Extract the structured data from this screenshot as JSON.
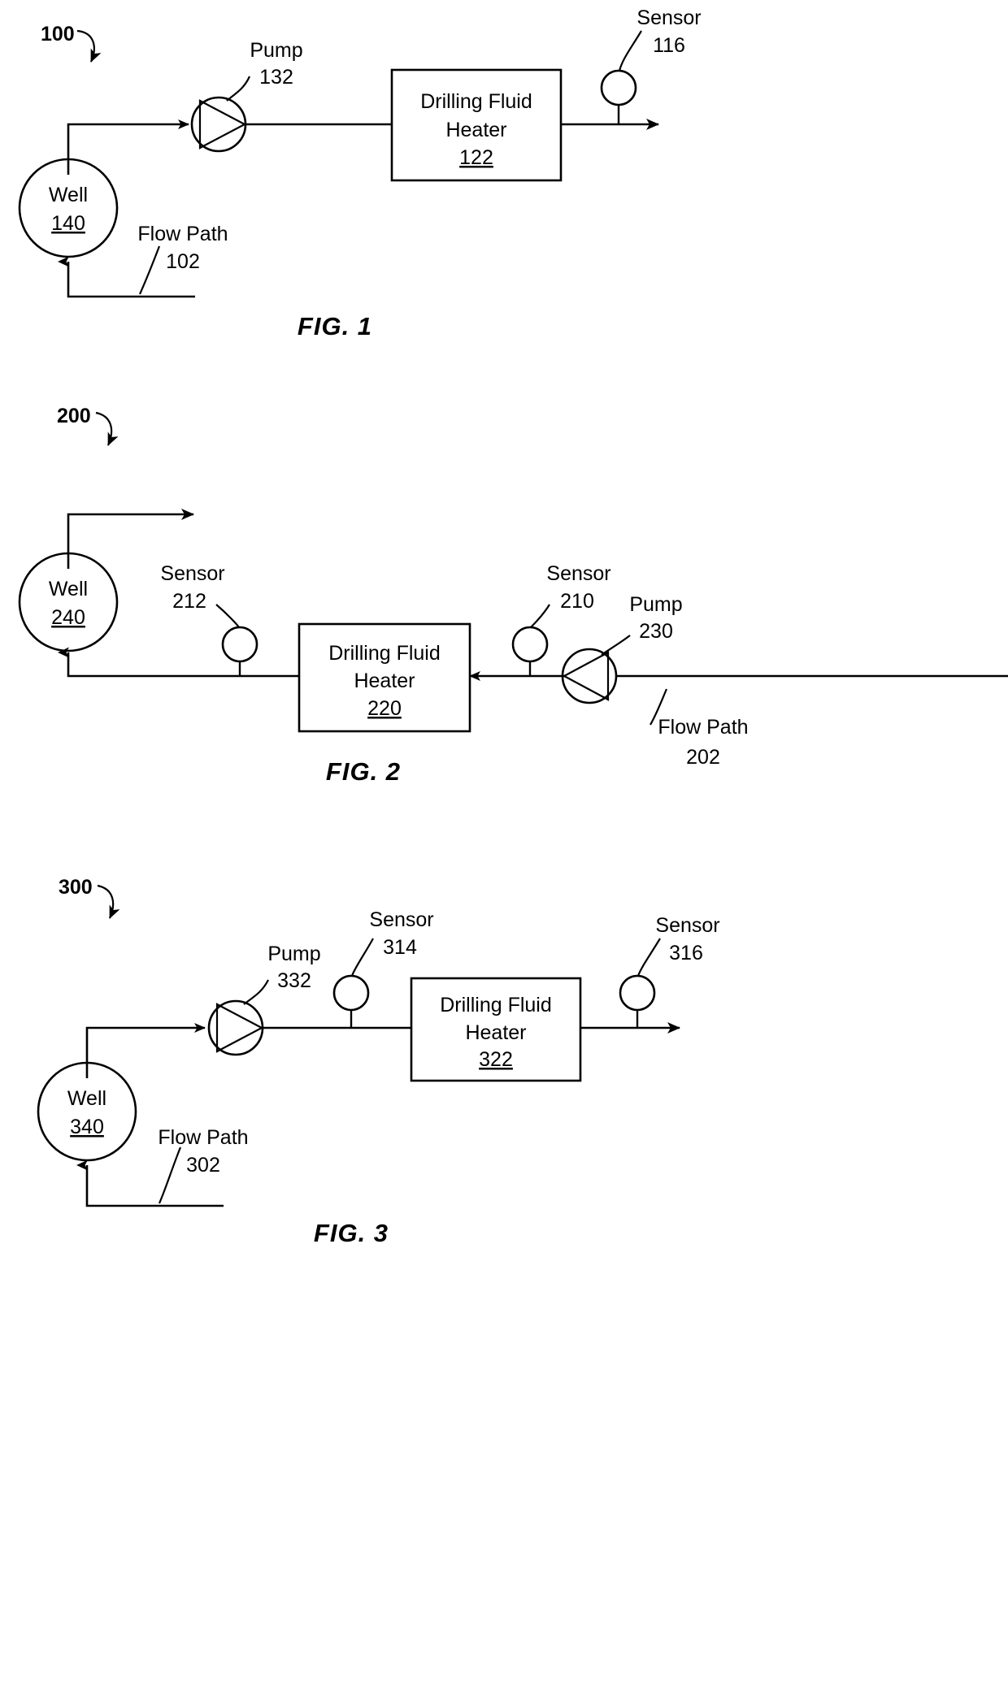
{
  "page": {
    "kind": "patent-drawing-sheet",
    "figure_count": 3,
    "stroke_color": "#000000",
    "background_color": "#ffffff"
  },
  "figures": [
    {
      "id": "fig1",
      "caption": "FIG. 1",
      "system_ref": "100",
      "nodes": {
        "well": {
          "label": "Well",
          "ref": "140"
        },
        "pump": {
          "label": "Pump",
          "ref": "132"
        },
        "heater": {
          "line1": "Drilling Fluid",
          "line2": "Heater",
          "ref": "122"
        },
        "sensor_out": {
          "label": "Sensor",
          "ref": "116"
        },
        "flow_path": {
          "label": "Flow Path",
          "ref": "102"
        }
      }
    },
    {
      "id": "fig2",
      "caption": "FIG. 2",
      "system_ref": "200",
      "nodes": {
        "well": {
          "label": "Well",
          "ref": "240"
        },
        "pump": {
          "label": "Pump",
          "ref": "230"
        },
        "heater": {
          "line1": "Drilling Fluid",
          "line2": "Heater",
          "ref": "220"
        },
        "sensor_out": {
          "label": "Sensor",
          "ref": "212"
        },
        "sensor_in": {
          "label": "Sensor",
          "ref": "210"
        },
        "flow_path": {
          "label": "Flow Path",
          "ref": "202"
        }
      }
    },
    {
      "id": "fig3",
      "caption": "FIG. 3",
      "system_ref": "300",
      "nodes": {
        "well": {
          "label": "Well",
          "ref": "340"
        },
        "pump": {
          "label": "Pump",
          "ref": "332"
        },
        "heater": {
          "line1": "Drilling Fluid",
          "line2": "Heater",
          "ref": "322"
        },
        "sensor_mid": {
          "label": "Sensor",
          "ref": "314"
        },
        "sensor_out": {
          "label": "Sensor",
          "ref": "316"
        },
        "flow_path": {
          "label": "Flow Path",
          "ref": "302"
        }
      }
    }
  ]
}
